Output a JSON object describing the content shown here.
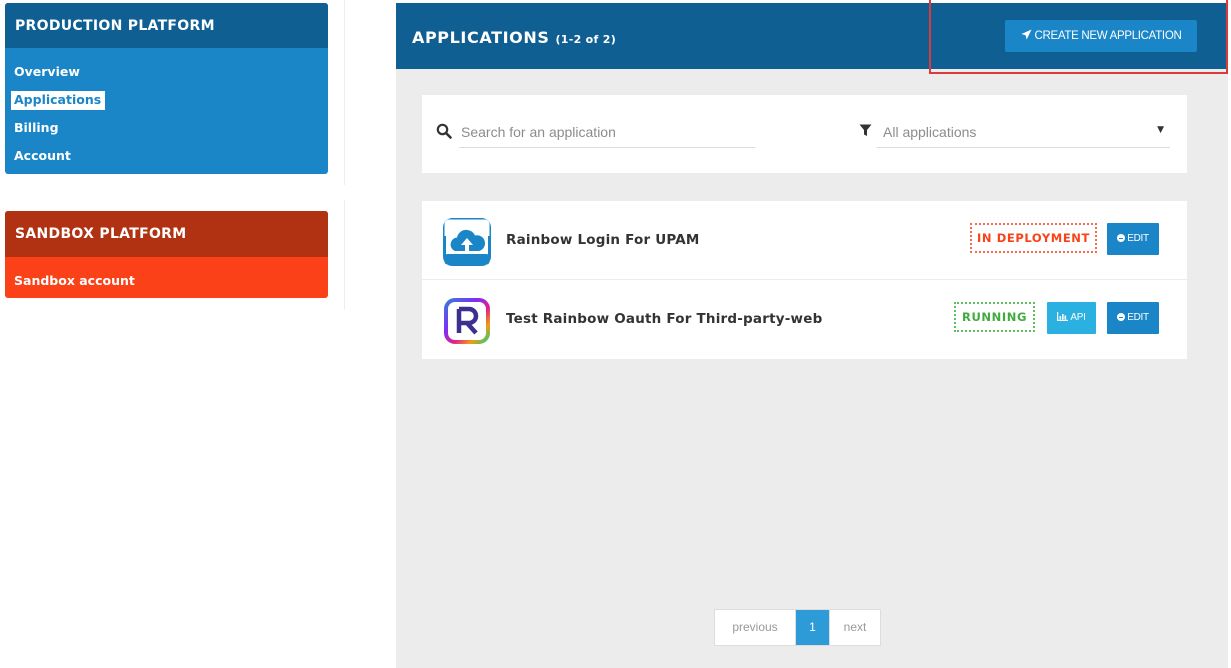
{
  "sidebar": {
    "production": {
      "title": "PRODUCTION PLATFORM",
      "items": [
        {
          "label": "Overview",
          "active": false
        },
        {
          "label": "Applications",
          "active": true
        },
        {
          "label": "Billing",
          "active": false
        },
        {
          "label": "Account",
          "active": false
        }
      ]
    },
    "sandbox": {
      "title": "SANDBOX PLATFORM",
      "items": [
        {
          "label": "Sandbox account"
        }
      ]
    }
  },
  "main": {
    "title": "APPLICATIONS",
    "count": "(1-2 of 2)",
    "create_button": {
      "label": "CREATE NEW APPLICATION",
      "icon": "paper-plane-icon"
    },
    "search": {
      "placeholder": "Search for an application",
      "value": ""
    },
    "filter": {
      "selected": "All applications"
    },
    "applications": [
      {
        "name": "Rainbow Login For UPAM",
        "status": "IN DEPLOYMENT",
        "edit_label": "EDIT"
      },
      {
        "name": "Test Rainbow Oauth For Third-party-web",
        "status": "RUNNING",
        "api_label": "API",
        "edit_label": "EDIT"
      }
    ],
    "pagination": {
      "previous": "previous",
      "current": "1",
      "next": "next"
    }
  },
  "colors": {
    "production_header": "#0f5f93",
    "production_body": "#1a86c7",
    "sandbox_header": "#b03212",
    "sandbox_body": "#fb4117",
    "status_deploy": "#fb4117",
    "status_running": "#3fab3f",
    "highlight": "#dc3b3b"
  }
}
